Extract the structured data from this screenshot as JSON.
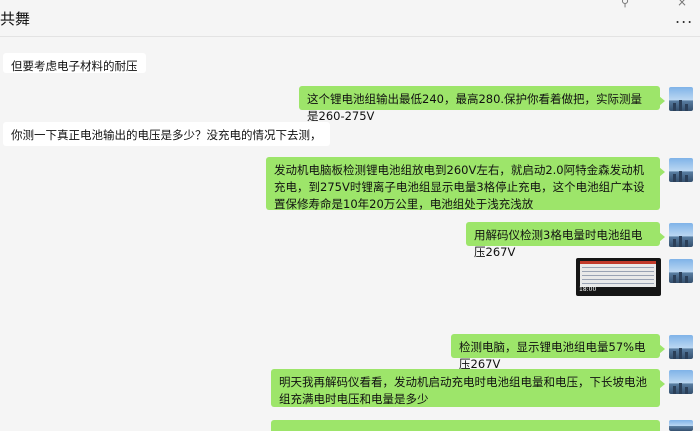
{
  "chat": {
    "title": "共舞",
    "pin_icon": "pin-icon",
    "close_icon": "close-icon",
    "more_label": "..."
  },
  "messages": [
    {
      "side": "left",
      "text": "但要考虑电子材料的耐压"
    },
    {
      "side": "right",
      "text": "这个锂电池组输出最低240，最高280.保护你看着做把，实际测量是260-275V"
    },
    {
      "side": "left",
      "text": "你测一下真正电池输出的电压是多少？没充电的情况下去测，"
    },
    {
      "side": "right",
      "text": "发动机电脑板检测锂电池组放电到260V左右，就启动2.0阿特金森发动机充电，到275V时锂离子电池组显示电量3格停止充电，这个电池组广本设置保修寿命是10年20万公里，电池组处于浅充浅放"
    },
    {
      "side": "right",
      "text": "用解码仪检测3格电量时电池组电压267V"
    },
    {
      "side": "right",
      "type": "image",
      "caption_time": "18:00"
    },
    {
      "side": "right",
      "text": "检测电脑，显示锂电池组电量57%电压267V"
    },
    {
      "side": "right",
      "text": "明天我再解码仪看看，发动机启动充电时电池组电量和电压，下长坡电池组充满电时电压和电量是多少"
    }
  ]
}
